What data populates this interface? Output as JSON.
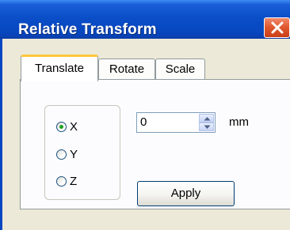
{
  "window": {
    "title": "Relative Transform"
  },
  "tabs": [
    {
      "label": "Translate",
      "active": true
    },
    {
      "label": "Rotate",
      "active": false
    },
    {
      "label": "Scale",
      "active": false
    }
  ],
  "axis_options": [
    {
      "label": "X",
      "selected": true
    },
    {
      "label": "Y",
      "selected": false
    },
    {
      "label": "Z",
      "selected": false
    }
  ],
  "amount": {
    "value": "0",
    "unit": "mm"
  },
  "actions": {
    "apply_label": "Apply"
  },
  "colors": {
    "title_bar": "#0747c0",
    "close_button": "#e25a31",
    "active_tab_highlight": "#ffc83c",
    "radio_selected": "#21a121"
  },
  "icons": {
    "close": "close-icon",
    "spin_up": "chevron-up-icon",
    "spin_down": "chevron-down-icon"
  }
}
